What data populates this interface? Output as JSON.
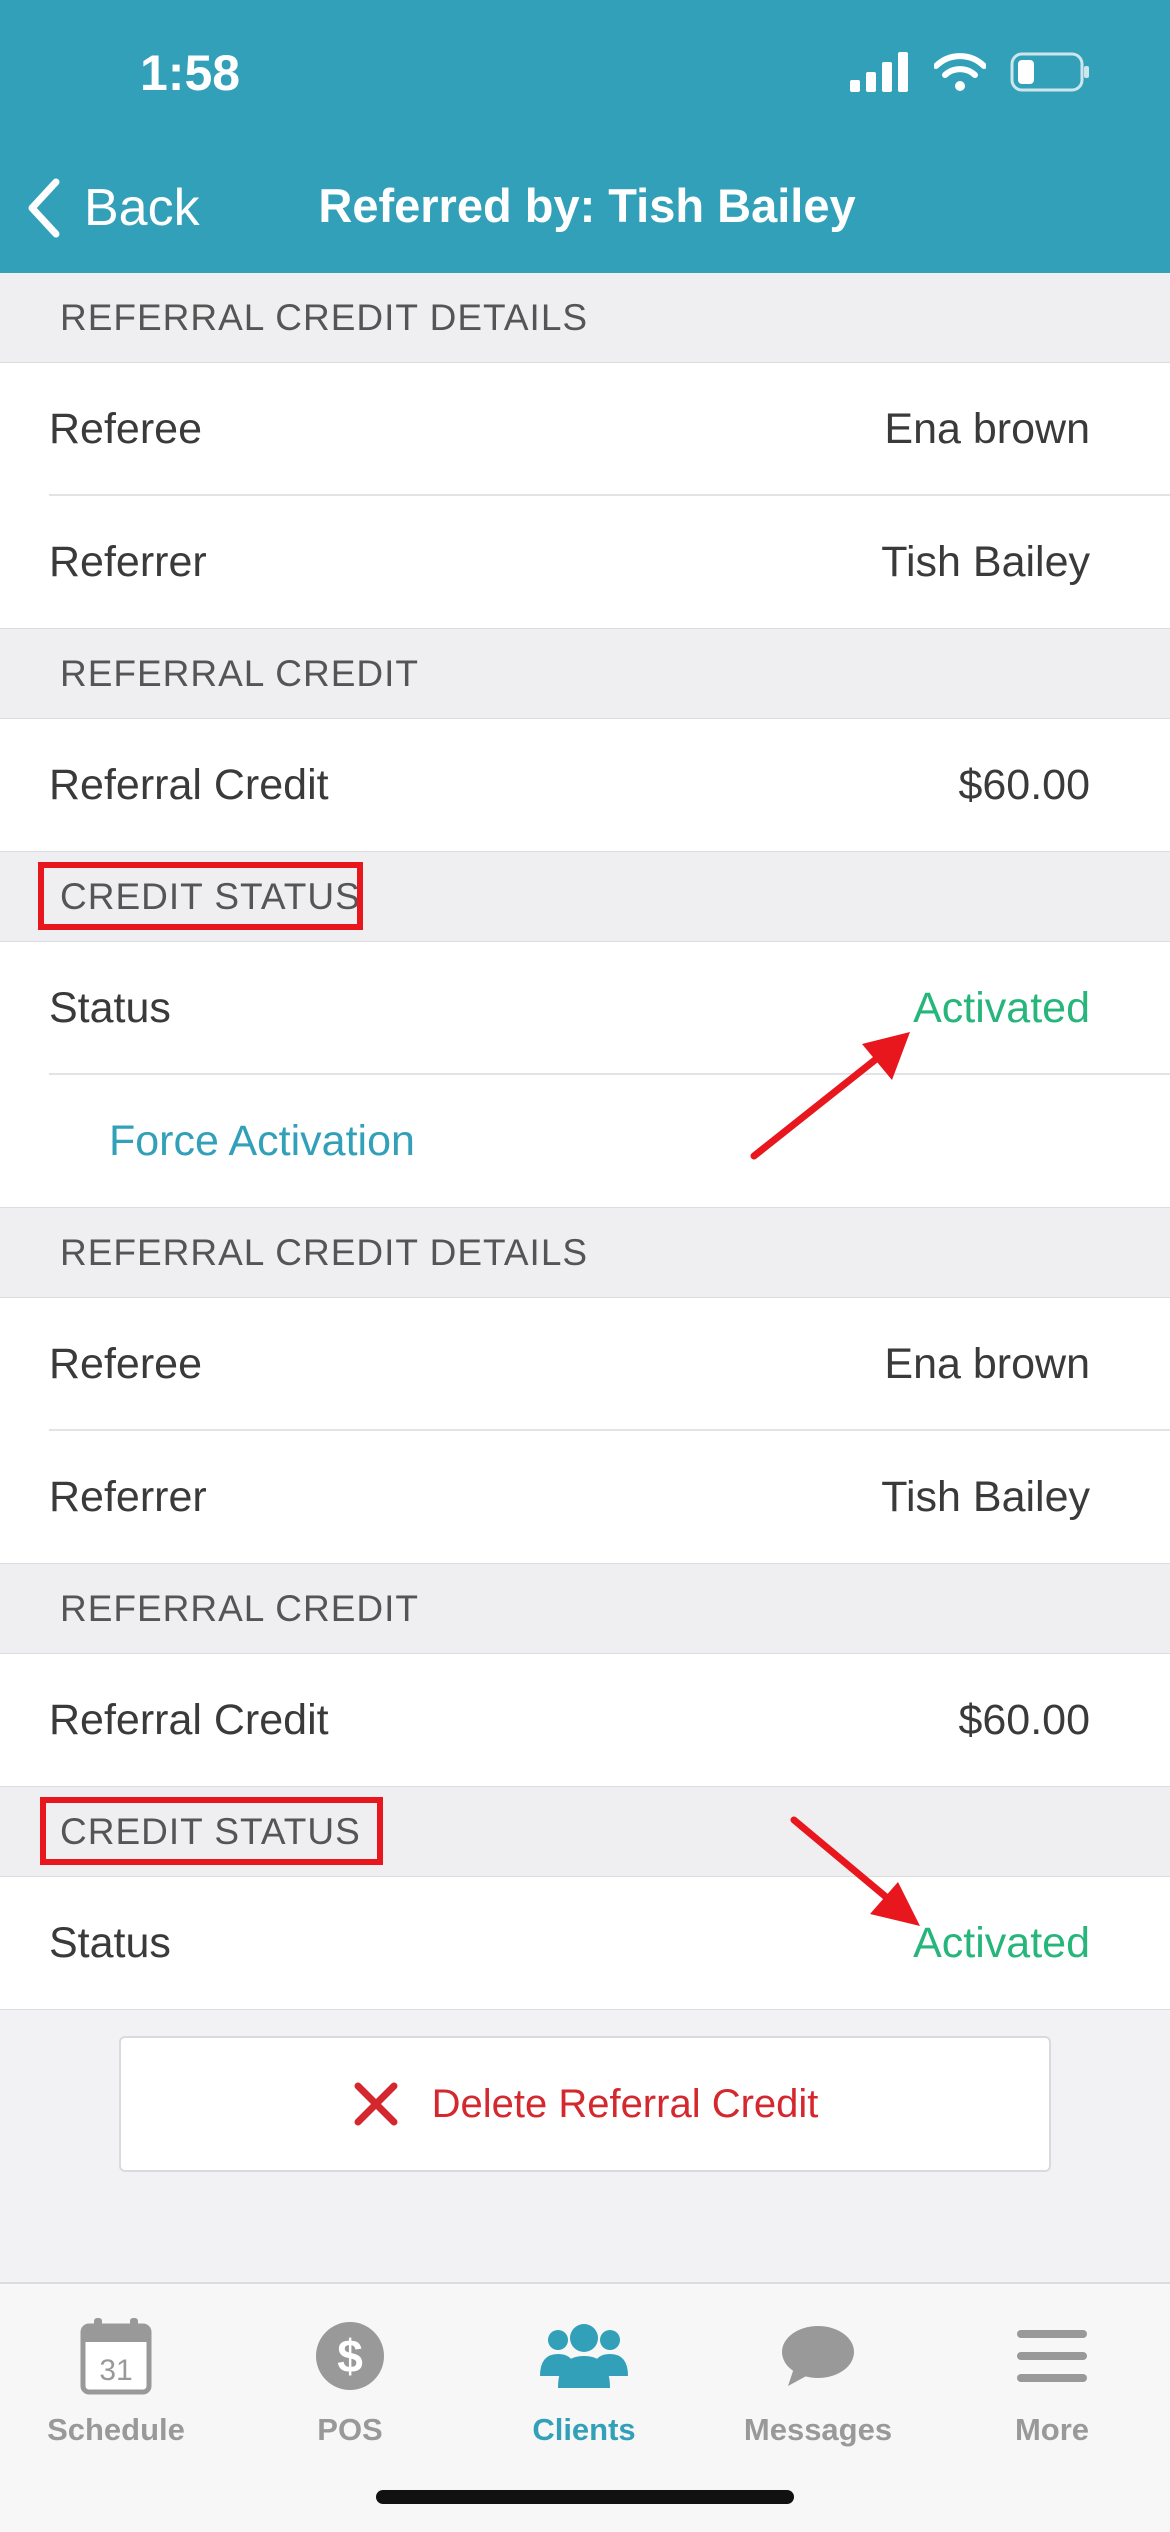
{
  "status_bar": {
    "time": "1:58"
  },
  "nav": {
    "back_label": "Back",
    "title": "Referred by: Tish Bailey"
  },
  "sections": [
    {
      "header": "REFERRAL CREDIT DETAILS",
      "rows": [
        {
          "label": "Referee",
          "value": "Ena brown"
        },
        {
          "label": "Referrer",
          "value": "Tish Bailey"
        }
      ]
    },
    {
      "header": "REFERRAL CREDIT",
      "rows": [
        {
          "label": "Referral Credit",
          "value": "$60.00"
        }
      ]
    },
    {
      "header": "CREDIT STATUS",
      "rows": [
        {
          "label": "Status",
          "value": "Activated"
        }
      ],
      "action": "Force Activation"
    },
    {
      "header": "REFERRAL CREDIT DETAILS",
      "rows": [
        {
          "label": "Referee",
          "value": "Ena brown"
        },
        {
          "label": "Referrer",
          "value": "Tish Bailey"
        }
      ]
    },
    {
      "header": "REFERRAL CREDIT",
      "rows": [
        {
          "label": "Referral Credit",
          "value": "$60.00"
        }
      ]
    },
    {
      "header": "CREDIT STATUS",
      "rows": [
        {
          "label": "Status",
          "value": "Activated"
        }
      ]
    }
  ],
  "delete_button": {
    "label": "Delete Referral Credit",
    "icon": "close-x-icon"
  },
  "tabs": [
    {
      "label": "Schedule",
      "icon": "calendar-icon",
      "calendar_day": "31"
    },
    {
      "label": "POS",
      "icon": "dollar-icon"
    },
    {
      "label": "Clients",
      "icon": "clients-icon",
      "active": true
    },
    {
      "label": "Messages",
      "icon": "chat-bubble-icon"
    },
    {
      "label": "More",
      "icon": "menu-icon"
    }
  ],
  "colors": {
    "header": "#32a0b8",
    "activated": "#26b57a",
    "delete": "#d4282e",
    "annotation": "#e8161d"
  }
}
